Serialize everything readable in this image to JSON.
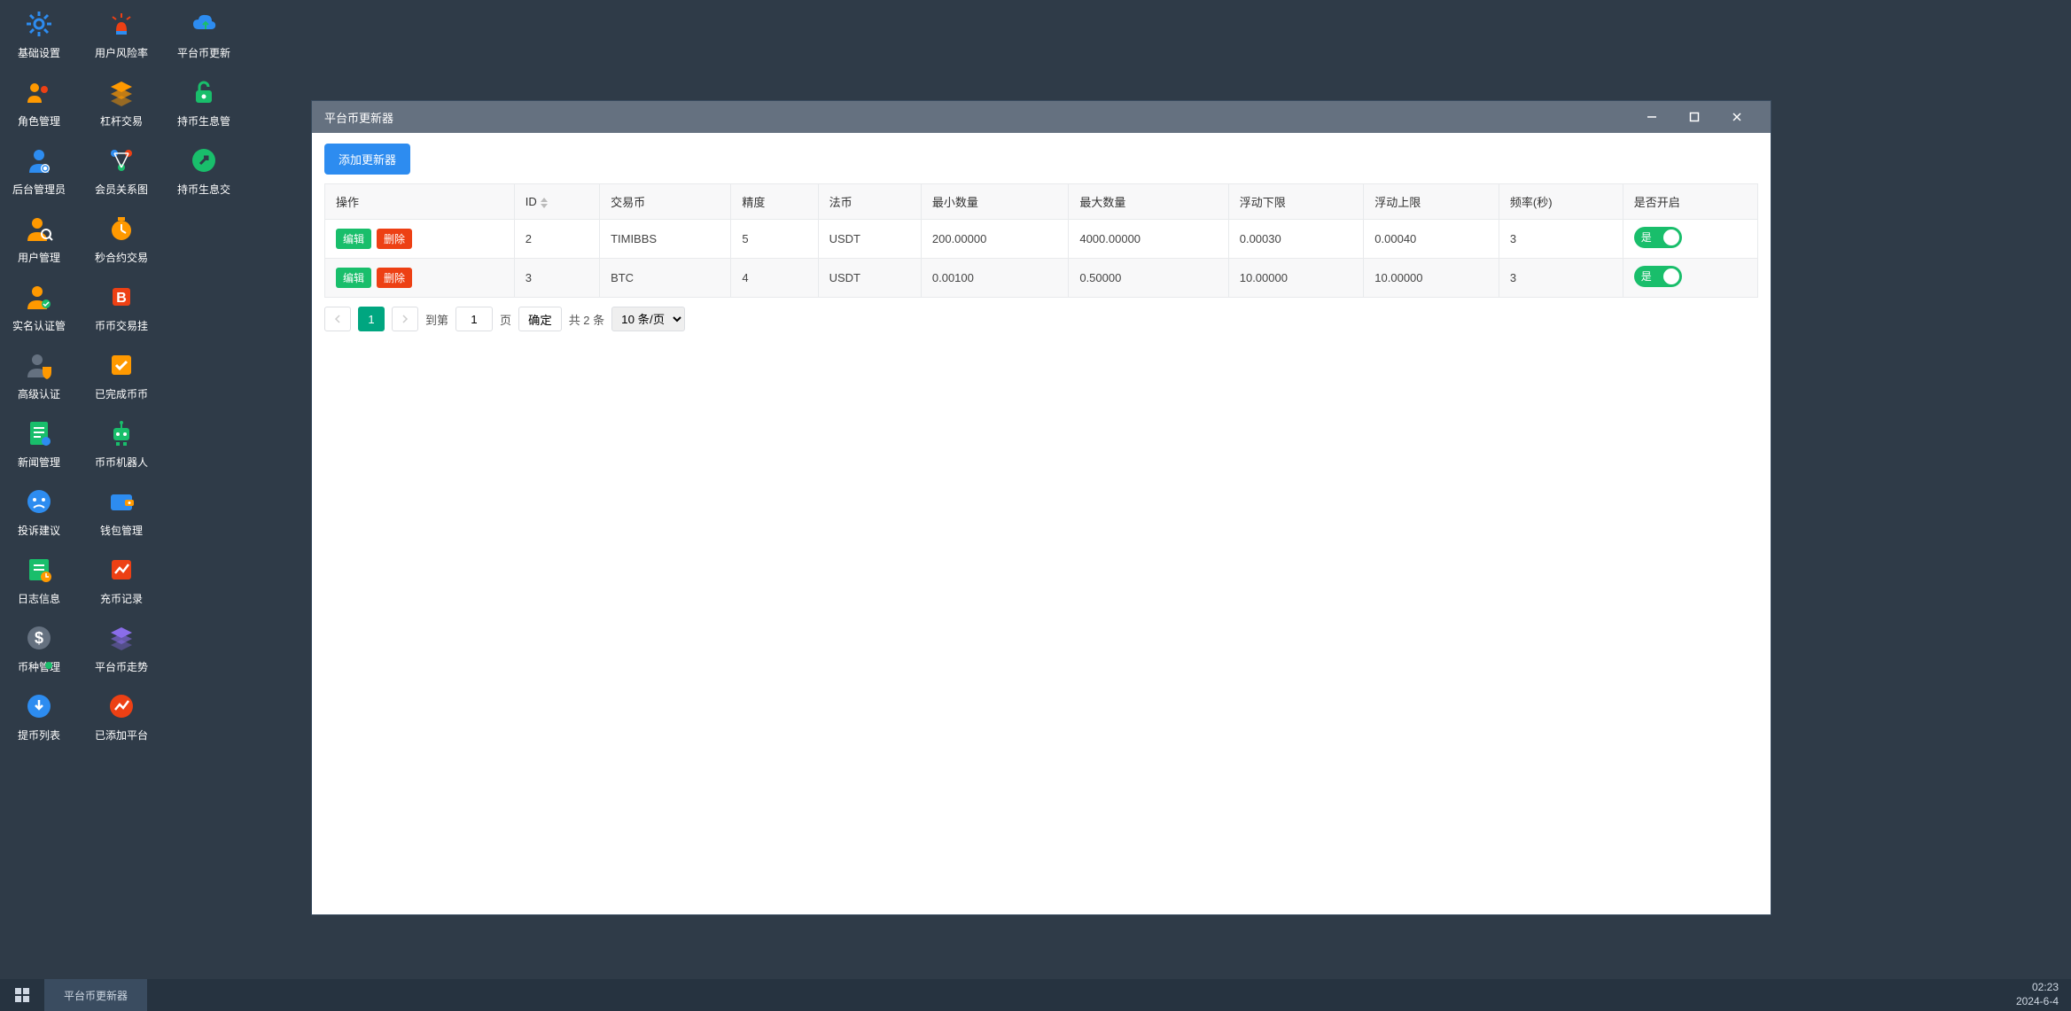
{
  "desktop": {
    "cols": [
      [
        {
          "label": "基础设置",
          "icon": "gear",
          "color": "#2d8cf0"
        },
        {
          "label": "角色管理",
          "icon": "users",
          "color": "#ff9900"
        },
        {
          "label": "后台管理员",
          "icon": "admin",
          "color": "#2d8cf0"
        },
        {
          "label": "用户管理",
          "icon": "usersearch",
          "color": "#ff9900"
        },
        {
          "label": "实名认证管",
          "icon": "idcard",
          "color": "#ff9900"
        },
        {
          "label": "高级认证",
          "icon": "shield",
          "color": "#657180"
        },
        {
          "label": "新闻管理",
          "icon": "doc",
          "color": "#19be6b"
        },
        {
          "label": "投诉建议",
          "icon": "complaint",
          "color": "#2d8cf0"
        },
        {
          "label": "日志信息",
          "icon": "log",
          "color": "#19be6b"
        },
        {
          "label": "币种管理",
          "icon": "dollar",
          "color": "#657180"
        },
        {
          "label": "提币列表",
          "icon": "withdraw",
          "color": "#2d8cf0",
          "badge": true
        }
      ],
      [
        {
          "label": "用户风险率",
          "icon": "alert",
          "color": "#ed4014"
        },
        {
          "label": "杠杆交易",
          "icon": "layers",
          "color": "#ff9900"
        },
        {
          "label": "会员关系图",
          "icon": "network",
          "color": "#2d8cf0"
        },
        {
          "label": "秒合约交易",
          "icon": "timer",
          "color": "#ff9900"
        },
        {
          "label": "币币交易挂",
          "icon": "bexchange",
          "color": "#ed4014"
        },
        {
          "label": "已完成币币",
          "icon": "check",
          "color": "#ff9900"
        },
        {
          "label": "币币机器人",
          "icon": "robot",
          "color": "#19be6b"
        },
        {
          "label": "钱包管理",
          "icon": "wallet",
          "color": "#2d8cf0"
        },
        {
          "label": "充币记录",
          "icon": "chartup",
          "color": "#ed4014"
        },
        {
          "label": "平台币走势",
          "icon": "trend",
          "color": "#8a6de9"
        },
        {
          "label": "已添加平台",
          "icon": "trendcircle",
          "color": "#ed4014"
        }
      ],
      [
        {
          "label": "平台币更新",
          "icon": "cloud",
          "color": "#2d8cf0"
        },
        {
          "label": "持币生息管",
          "icon": "lock",
          "color": "#19be6b"
        },
        {
          "label": "持币生息交",
          "icon": "lockarrow",
          "color": "#19be6b"
        }
      ]
    ]
  },
  "window": {
    "title": "平台币更新器",
    "add_btn": "添加更新器",
    "columns": [
      "操作",
      "ID",
      "交易币",
      "精度",
      "法币",
      "最小数量",
      "最大数量",
      "浮动下限",
      "浮动上限",
      "频率(秒)",
      "是否开启"
    ],
    "edit_label": "编辑",
    "del_label": "删除",
    "switch_label": "是",
    "rows": [
      {
        "id": "2",
        "trade": "TIMIBBS",
        "precision": "5",
        "fiat": "USDT",
        "min": "200.00000",
        "max": "4000.00000",
        "low": "0.00030",
        "high": "0.00040",
        "freq": "3"
      },
      {
        "id": "3",
        "trade": "BTC",
        "precision": "4",
        "fiat": "USDT",
        "min": "0.00100",
        "max": "0.50000",
        "low": "10.00000",
        "high": "10.00000",
        "freq": "3"
      }
    ],
    "pager": {
      "current": "1",
      "to_label": "到第",
      "jump_value": "1",
      "page_label": "页",
      "go_label": "确定",
      "total_label": "共 2 条",
      "page_size": "10 条/页"
    }
  },
  "taskbar": {
    "task_label": "平台币更新器",
    "time": "02:23",
    "date": "2024-6-4"
  }
}
